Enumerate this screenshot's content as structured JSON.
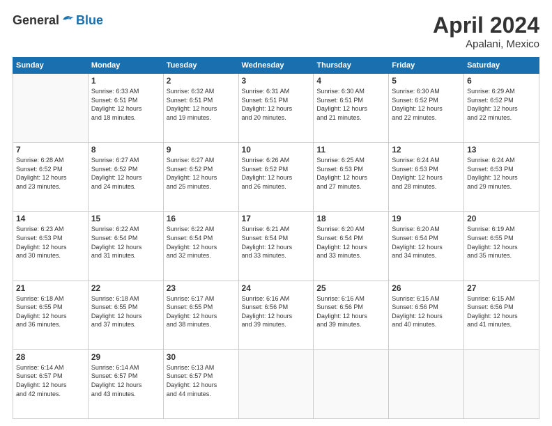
{
  "header": {
    "logo_general": "General",
    "logo_blue": "Blue",
    "month_title": "April 2024",
    "location": "Apalani, Mexico"
  },
  "weekdays": [
    "Sunday",
    "Monday",
    "Tuesday",
    "Wednesday",
    "Thursday",
    "Friday",
    "Saturday"
  ],
  "weeks": [
    [
      {
        "day": "",
        "info": ""
      },
      {
        "day": "1",
        "info": "Sunrise: 6:33 AM\nSunset: 6:51 PM\nDaylight: 12 hours\nand 18 minutes."
      },
      {
        "day": "2",
        "info": "Sunrise: 6:32 AM\nSunset: 6:51 PM\nDaylight: 12 hours\nand 19 minutes."
      },
      {
        "day": "3",
        "info": "Sunrise: 6:31 AM\nSunset: 6:51 PM\nDaylight: 12 hours\nand 20 minutes."
      },
      {
        "day": "4",
        "info": "Sunrise: 6:30 AM\nSunset: 6:51 PM\nDaylight: 12 hours\nand 21 minutes."
      },
      {
        "day": "5",
        "info": "Sunrise: 6:30 AM\nSunset: 6:52 PM\nDaylight: 12 hours\nand 22 minutes."
      },
      {
        "day": "6",
        "info": "Sunrise: 6:29 AM\nSunset: 6:52 PM\nDaylight: 12 hours\nand 22 minutes."
      }
    ],
    [
      {
        "day": "7",
        "info": "Sunrise: 6:28 AM\nSunset: 6:52 PM\nDaylight: 12 hours\nand 23 minutes."
      },
      {
        "day": "8",
        "info": "Sunrise: 6:27 AM\nSunset: 6:52 PM\nDaylight: 12 hours\nand 24 minutes."
      },
      {
        "day": "9",
        "info": "Sunrise: 6:27 AM\nSunset: 6:52 PM\nDaylight: 12 hours\nand 25 minutes."
      },
      {
        "day": "10",
        "info": "Sunrise: 6:26 AM\nSunset: 6:52 PM\nDaylight: 12 hours\nand 26 minutes."
      },
      {
        "day": "11",
        "info": "Sunrise: 6:25 AM\nSunset: 6:53 PM\nDaylight: 12 hours\nand 27 minutes."
      },
      {
        "day": "12",
        "info": "Sunrise: 6:24 AM\nSunset: 6:53 PM\nDaylight: 12 hours\nand 28 minutes."
      },
      {
        "day": "13",
        "info": "Sunrise: 6:24 AM\nSunset: 6:53 PM\nDaylight: 12 hours\nand 29 minutes."
      }
    ],
    [
      {
        "day": "14",
        "info": "Sunrise: 6:23 AM\nSunset: 6:53 PM\nDaylight: 12 hours\nand 30 minutes."
      },
      {
        "day": "15",
        "info": "Sunrise: 6:22 AM\nSunset: 6:54 PM\nDaylight: 12 hours\nand 31 minutes."
      },
      {
        "day": "16",
        "info": "Sunrise: 6:22 AM\nSunset: 6:54 PM\nDaylight: 12 hours\nand 32 minutes."
      },
      {
        "day": "17",
        "info": "Sunrise: 6:21 AM\nSunset: 6:54 PM\nDaylight: 12 hours\nand 33 minutes."
      },
      {
        "day": "18",
        "info": "Sunrise: 6:20 AM\nSunset: 6:54 PM\nDaylight: 12 hours\nand 33 minutes."
      },
      {
        "day": "19",
        "info": "Sunrise: 6:20 AM\nSunset: 6:54 PM\nDaylight: 12 hours\nand 34 minutes."
      },
      {
        "day": "20",
        "info": "Sunrise: 6:19 AM\nSunset: 6:55 PM\nDaylight: 12 hours\nand 35 minutes."
      }
    ],
    [
      {
        "day": "21",
        "info": "Sunrise: 6:18 AM\nSunset: 6:55 PM\nDaylight: 12 hours\nand 36 minutes."
      },
      {
        "day": "22",
        "info": "Sunrise: 6:18 AM\nSunset: 6:55 PM\nDaylight: 12 hours\nand 37 minutes."
      },
      {
        "day": "23",
        "info": "Sunrise: 6:17 AM\nSunset: 6:55 PM\nDaylight: 12 hours\nand 38 minutes."
      },
      {
        "day": "24",
        "info": "Sunrise: 6:16 AM\nSunset: 6:56 PM\nDaylight: 12 hours\nand 39 minutes."
      },
      {
        "day": "25",
        "info": "Sunrise: 6:16 AM\nSunset: 6:56 PM\nDaylight: 12 hours\nand 39 minutes."
      },
      {
        "day": "26",
        "info": "Sunrise: 6:15 AM\nSunset: 6:56 PM\nDaylight: 12 hours\nand 40 minutes."
      },
      {
        "day": "27",
        "info": "Sunrise: 6:15 AM\nSunset: 6:56 PM\nDaylight: 12 hours\nand 41 minutes."
      }
    ],
    [
      {
        "day": "28",
        "info": "Sunrise: 6:14 AM\nSunset: 6:57 PM\nDaylight: 12 hours\nand 42 minutes."
      },
      {
        "day": "29",
        "info": "Sunrise: 6:14 AM\nSunset: 6:57 PM\nDaylight: 12 hours\nand 43 minutes."
      },
      {
        "day": "30",
        "info": "Sunrise: 6:13 AM\nSunset: 6:57 PM\nDaylight: 12 hours\nand 44 minutes."
      },
      {
        "day": "",
        "info": ""
      },
      {
        "day": "",
        "info": ""
      },
      {
        "day": "",
        "info": ""
      },
      {
        "day": "",
        "info": ""
      }
    ]
  ]
}
